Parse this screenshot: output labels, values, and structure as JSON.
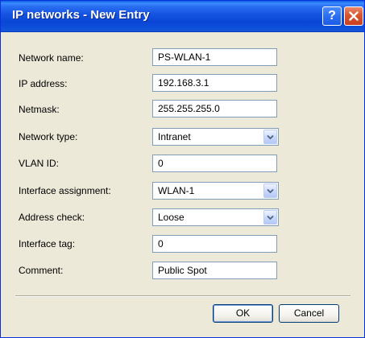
{
  "window": {
    "title": "IP networks - New Entry",
    "help_glyph": "?",
    "accent_color": "#0a46d6",
    "close_color": "#d9542d"
  },
  "form": {
    "network_name": {
      "label": "Network name:",
      "value": "PS-WLAN-1"
    },
    "ip_address": {
      "label": "IP address:",
      "value": "192.168.3.1"
    },
    "netmask": {
      "label": "Netmask:",
      "value": "255.255.255.0"
    },
    "network_type": {
      "label": "Network type:",
      "value": "Intranet"
    },
    "vlan_id": {
      "label": "VLAN ID:",
      "value": "0"
    },
    "interface_assignment": {
      "label": "Interface assignment:",
      "value": "WLAN-1"
    },
    "address_check": {
      "label": "Address check:",
      "value": "Loose"
    },
    "interface_tag": {
      "label": "Interface tag:",
      "value": "0"
    },
    "comment": {
      "label": "Comment:",
      "value": "Public Spot"
    }
  },
  "buttons": {
    "ok": "OK",
    "cancel": "Cancel"
  },
  "icons": {
    "help": "help-icon",
    "close": "close-icon",
    "dropdown": "chevron-down-icon"
  }
}
